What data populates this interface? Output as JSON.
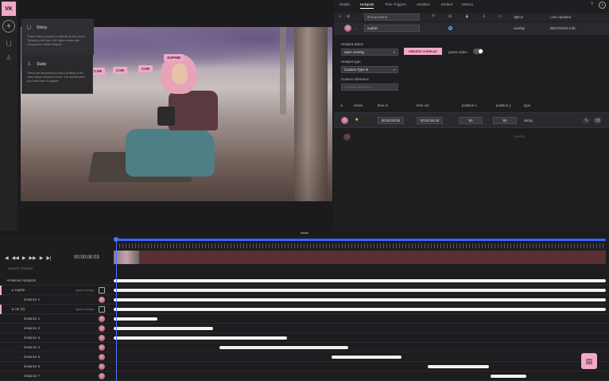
{
  "app": {
    "logo_text": "VK"
  },
  "rail": {
    "add_icon": "plus-icon",
    "magnet_icon": "magnet-icon",
    "person_icon": "person-icon"
  },
  "popover": {
    "sticky": {
      "title": "Sticky",
      "desc": "These stick to people or objects as they move. Typically you'll see a 5x higher views rate compared to static hotspots"
    },
    "static": {
      "title": "Static",
      "desc": "These are anchored to a fixed position in the video frame and don't move. You decide when you want them to appear"
    }
  },
  "video": {
    "labels": [
      "SOPHIE",
      "CAR",
      "CAR",
      "CAR"
    ]
  },
  "tabs": [
    "Details",
    "Hotspots",
    "Time Triggers",
    "Subtitles",
    "Embed",
    "Metrics"
  ],
  "active_tab": "Hotspots",
  "hotspots_table": {
    "group_placeholder": "Group Name",
    "col_action": "Action",
    "col_updated": "Last Updated",
    "row": {
      "name": "sophie",
      "action": "overlay",
      "updated": "06/17/2019 4:26"
    }
  },
  "form": {
    "hotspot_action_label": "Hotspot action",
    "hotspot_action_value": "open overlay",
    "create_overlay": "CREATE OVERLAY",
    "pause_video": "pause video",
    "hotspot_type_label": "Hotspot type",
    "hotspot_type_value": "Custom Type B",
    "custom_reference_label": "Custom reference",
    "custom_reference_placeholder": "Custom reference"
  },
  "instances": {
    "headers": [
      "active",
      "time in",
      "time out",
      "position x",
      "position y",
      "type"
    ],
    "row": {
      "time_in": "00:00:00:05",
      "time_out": "00:00:18:18",
      "pos_x": "50",
      "pos_y": "50",
      "type": "sticky"
    },
    "row2": {
      "type": "overlay"
    }
  },
  "timeline": {
    "timecode": "00:00:00:03",
    "search_placeholder": "Search Timeline",
    "rows": [
      {
        "label": "Named Hotspots",
        "sub": "",
        "indent": 1
      },
      {
        "label": "sophie",
        "sub": "open overlay",
        "indent": 2
      },
      {
        "label": "instance 1",
        "sub": "",
        "indent": 3
      },
      {
        "label": "car (3)",
        "sub": "open overlay",
        "indent": 2
      },
      {
        "label": "instance 1",
        "sub": "",
        "indent": 3
      },
      {
        "label": "instance 2",
        "sub": "",
        "indent": 3
      },
      {
        "label": "instance 3",
        "sub": "",
        "indent": 3
      },
      {
        "label": "instance 4",
        "sub": "",
        "indent": 3
      },
      {
        "label": "instance 5",
        "sub": "",
        "indent": 3
      },
      {
        "label": "instance 6",
        "sub": "",
        "indent": 3
      },
      {
        "label": "instance 7",
        "sub": "",
        "indent": 3
      }
    ]
  },
  "colors": {
    "accent_pink": "#f1a9c7",
    "accent_blue": "#4f72ff",
    "bg": "#1b1b1d"
  }
}
